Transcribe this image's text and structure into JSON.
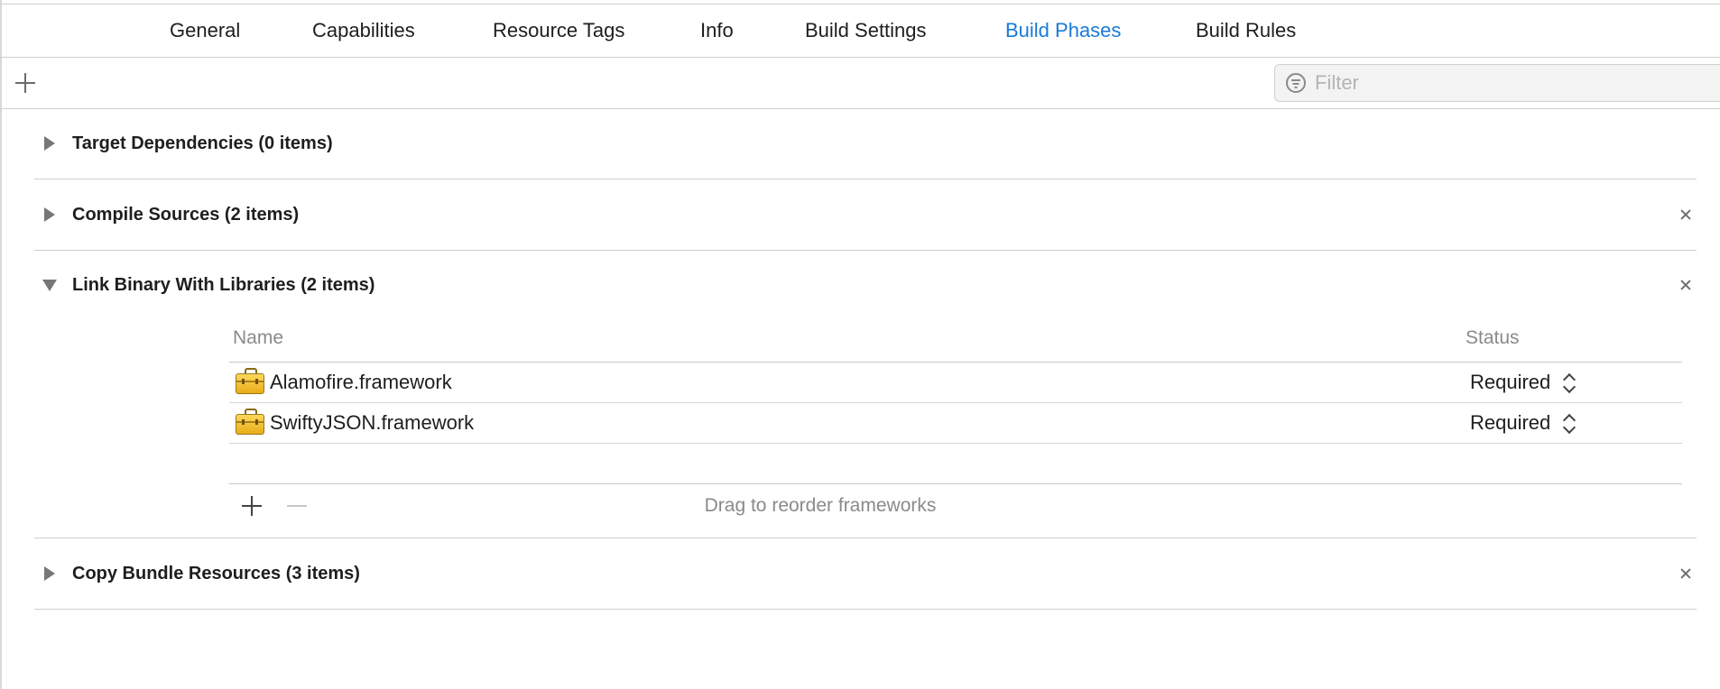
{
  "tabs": [
    {
      "label": "General",
      "active": false
    },
    {
      "label": "Capabilities",
      "active": false
    },
    {
      "label": "Resource Tags",
      "active": false
    },
    {
      "label": "Info",
      "active": false
    },
    {
      "label": "Build Settings",
      "active": false
    },
    {
      "label": "Build Phases",
      "active": true
    },
    {
      "label": "Build Rules",
      "active": false
    }
  ],
  "toolbar": {
    "add_icon": "plus-icon",
    "filter_icon": "filter-icon",
    "filter_placeholder": "Filter",
    "filter_value": ""
  },
  "phases": [
    {
      "title": "Target Dependencies (0 items)",
      "expanded": false,
      "deletable": false
    },
    {
      "title": "Compile Sources (2 items)",
      "expanded": false,
      "deletable": true
    },
    {
      "title": "Link Binary With Libraries (2 items)",
      "expanded": true,
      "deletable": true
    },
    {
      "title": "Copy Bundle Resources (3 items)",
      "expanded": false,
      "deletable": true
    }
  ],
  "libraries": {
    "columns": {
      "name": "Name",
      "status": "Status"
    },
    "rows": [
      {
        "name": "Alamofire.framework",
        "status": "Required",
        "icon": "framework-icon"
      },
      {
        "name": "SwiftyJSON.framework",
        "status": "Required",
        "icon": "framework-icon"
      }
    ],
    "hint": "Drag to reorder frameworks"
  },
  "colors": {
    "accent": "#1a7ad8",
    "separator": "#cfcfcf",
    "secondary_text": "#8a8a8a"
  }
}
